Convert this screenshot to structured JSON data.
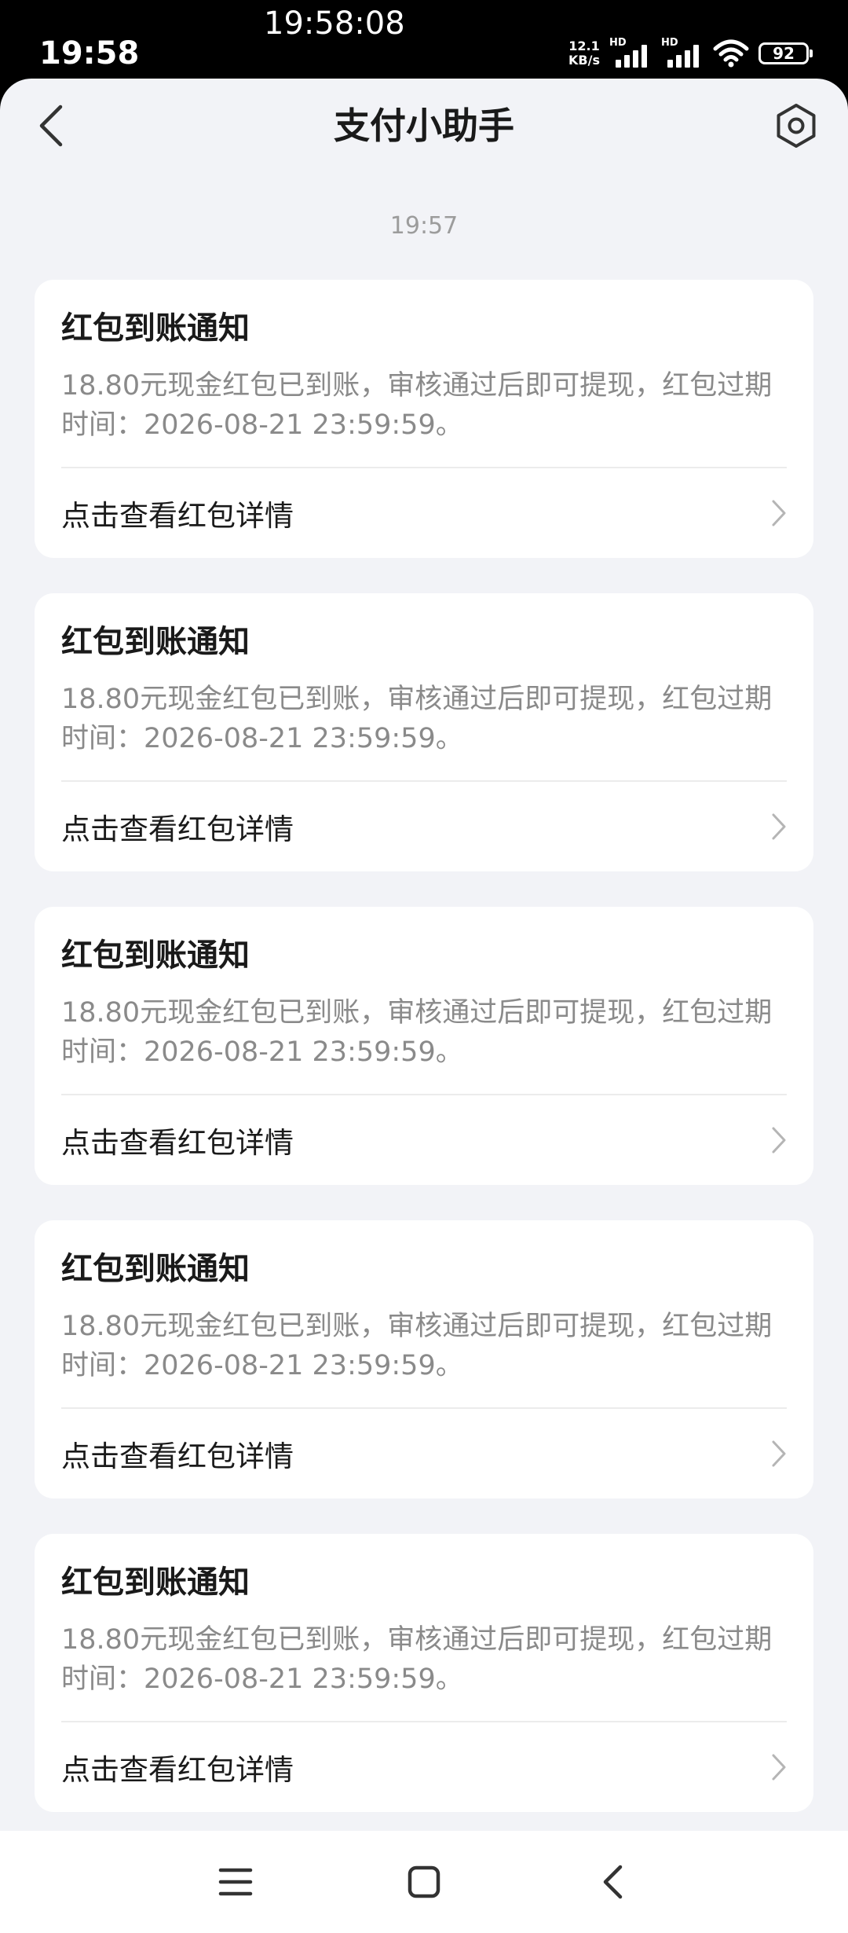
{
  "status_bar": {
    "time": "19:58",
    "overlay_clock": "19:58:08",
    "net_speed_value": "12.1",
    "net_speed_unit": "KB/s",
    "hd_label_1": "HD",
    "hd_label_2": "HD",
    "battery_level": "92",
    "icons": [
      "signal-icon",
      "signal-icon",
      "wifi-icon",
      "battery-icon"
    ]
  },
  "header": {
    "title": "支付小助手",
    "back_icon": "chevron-left-icon",
    "settings_icon": "settings-gear-icon"
  },
  "timestamp": "19:57",
  "messages": [
    {
      "title": "红包到账通知",
      "body": "18.80元现金红包已到账，审核通过后即可提现，红包过期\n时间：2026-08-21 23:59:59。",
      "link_label": "点击查看红包详情"
    },
    {
      "title": "红包到账通知",
      "body": "18.80元现金红包已到账，审核通过后即可提现，红包过期\n时间：2026-08-21 23:59:59。",
      "link_label": "点击查看红包详情"
    },
    {
      "title": "红包到账通知",
      "body": "18.80元现金红包已到账，审核通过后即可提现，红包过期\n时间：2026-08-21 23:59:59。",
      "link_label": "点击查看红包详情"
    },
    {
      "title": "红包到账通知",
      "body": "18.80元现金红包已到账，审核通过后即可提现，红包过期\n时间：2026-08-21 23:59:59。",
      "link_label": "点击查看红包详情"
    },
    {
      "title": "红包到账通知",
      "body": "18.80元现金红包已到账，审核通过后即可提现，红包过期\n时间：2026-08-21 23:59:59。",
      "link_label": "点击查看红包详情"
    }
  ],
  "system_nav": {
    "icons": [
      "menu-icon",
      "home-icon",
      "back-icon"
    ]
  },
  "colors": {
    "page_background": "#f2f3f7",
    "card_background": "#ffffff",
    "title_text": "#1a1a1a",
    "secondary_text": "#8a8a8a",
    "timestamp_text": "#9c9c9c",
    "status_bar_background": "#000000"
  }
}
